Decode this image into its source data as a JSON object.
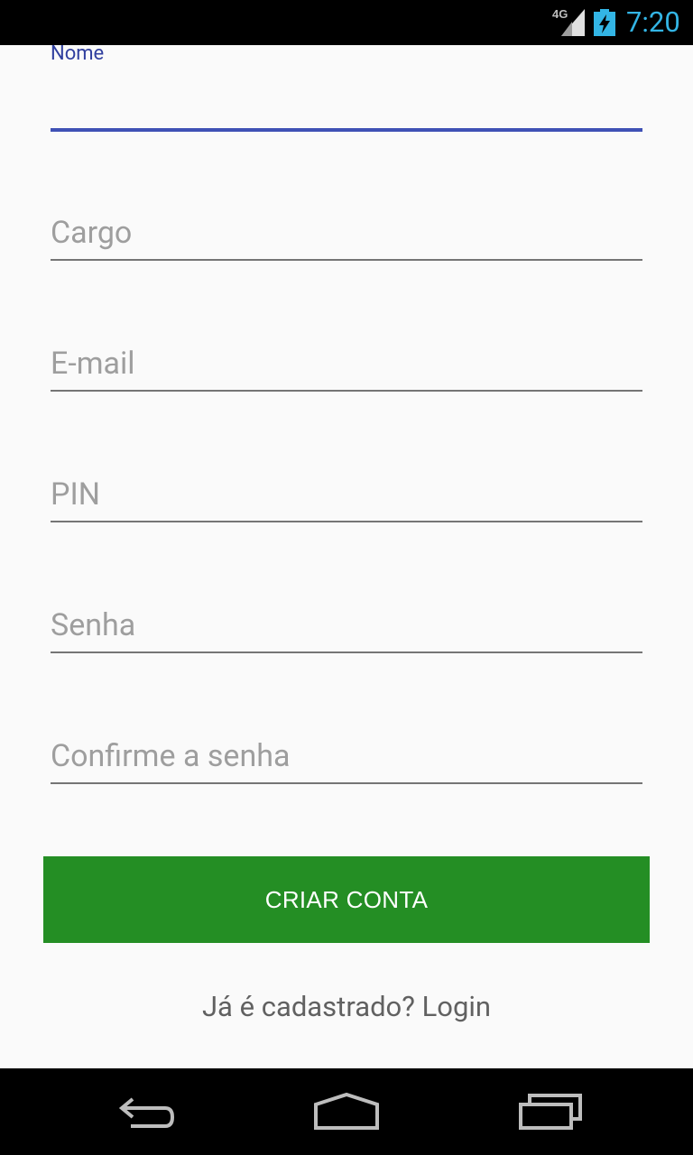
{
  "status_bar": {
    "network_label": "4G",
    "time": "7:20",
    "icons": [
      "signal-icon",
      "battery-charging-icon"
    ]
  },
  "form": {
    "fields": [
      {
        "name": "Nome",
        "value": "",
        "focused": true
      },
      {
        "name": "Cargo",
        "value": ""
      },
      {
        "name": "E-mail",
        "value": ""
      },
      {
        "name": "PIN",
        "value": ""
      },
      {
        "name": "Senha",
        "value": ""
      },
      {
        "name": "Confirme a senha",
        "value": ""
      }
    ],
    "submit_label": "CRIAR CONTA",
    "login_prompt": "Já é cadastrado? Login"
  },
  "nav_bar": {
    "icons": [
      "back-icon",
      "home-icon",
      "recent-apps-icon"
    ]
  },
  "colors": {
    "accent": "#3f51b5",
    "button": "#248e24",
    "status_clock": "#33b5e5"
  }
}
